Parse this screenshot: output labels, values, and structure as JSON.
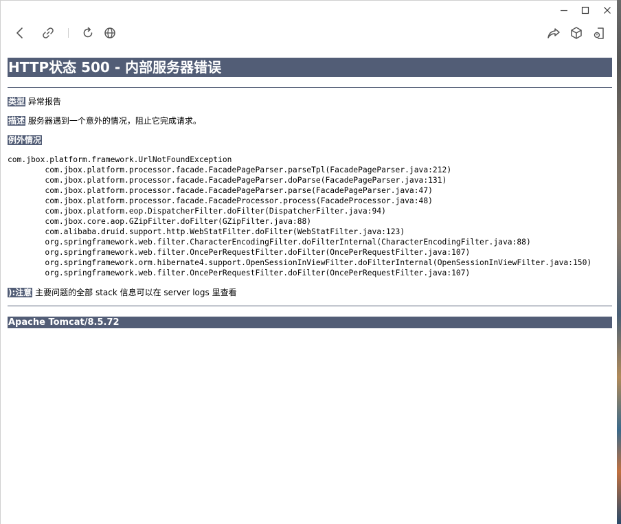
{
  "window": {
    "controls": [
      "minimize",
      "maximize",
      "close"
    ]
  },
  "toolbar": {
    "left": [
      "back-icon",
      "link-icon",
      "refresh-icon",
      "globe-icon"
    ],
    "right": [
      "share-icon",
      "cube-icon",
      "exit-icon"
    ]
  },
  "page": {
    "title": "HTTP状态 500 - 内部服务器错误",
    "type_label": "类型",
    "type_value": "异常报告",
    "desc_label": "描述",
    "desc_value": "服务器遇到一个意外的情况，阻止它完成请求。",
    "exception_label": "例外情况",
    "stack_trace": "com.jbox.platform.framework.UrlNotFoundException\n\tcom.jbox.platform.processor.facade.FacadePageParser.parseTpl(FacadePageParser.java:212)\n\tcom.jbox.platform.processor.facade.FacadePageParser.doParse(FacadePageParser.java:131)\n\tcom.jbox.platform.processor.facade.FacadePageParser.parse(FacadePageParser.java:47)\n\tcom.jbox.platform.processor.facade.FacadeProcessor.process(FacadeProcessor.java:48)\n\tcom.jbox.platform.eop.DispatcherFilter.doFilter(DispatcherFilter.java:94)\n\tcom.jbox.core.aop.GZipFilter.doFilter(GZipFilter.java:88)\n\tcom.alibaba.druid.support.http.WebStatFilter.doFilter(WebStatFilter.java:123)\n\torg.springframework.web.filter.CharacterEncodingFilter.doFilterInternal(CharacterEncodingFilter.java:88)\n\torg.springframework.web.filter.OncePerRequestFilter.doFilter(OncePerRequestFilter.java:107)\n\torg.springframework.orm.hibernate4.support.OpenSessionInViewFilter.doFilterInternal(OpenSessionInViewFilter.java:150)\n\torg.springframework.web.filter.OncePerRequestFilter.doFilter(OncePerRequestFilter.java:107)",
    "note_label": "):注意",
    "note_value": "主要问题的全部 stack 信息可以在 server logs 里查看",
    "footer": "Apache Tomcat/8.5.72"
  },
  "colors": {
    "header_bg": "#525d76",
    "header_text": "#ffffff",
    "icon": "#555555"
  }
}
